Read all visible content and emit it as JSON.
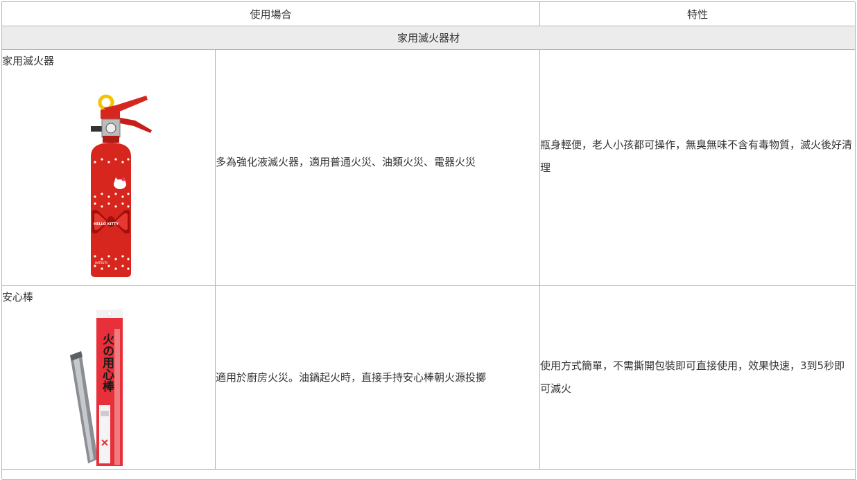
{
  "table": {
    "header": {
      "col_usage": "使用場合",
      "col_feature": "特性"
    },
    "section_title": "家用滅火器材",
    "rows": [
      {
        "name": "家用滅火器",
        "usage": "多為強化液滅火器，適用普通火災、油類火災、電器火災",
        "feature": "瓶身輕便，老人小孩都可操作，無臭無味不含有毒物質，滅火後好清理",
        "image_labels": {
          "brand": "HELLO KITTY",
          "maker": "HATSUTA"
        }
      },
      {
        "name": "安心棒",
        "usage": "適用於廚房火災。油鍋起火時，直接手持安心棒朝火源投擲",
        "feature": "使用方式簡單，不需撕開包裝即可直接使用，效果快速，3到5秒即可滅火",
        "image_labels": {
          "package_title": "火の用心棒"
        }
      }
    ]
  },
  "colors": {
    "border": "#b5b5b5",
    "section_bg": "#ececec",
    "text": "#333333",
    "extinguisher_red": "#d7261e",
    "handle_yellow": "#f4c400"
  }
}
